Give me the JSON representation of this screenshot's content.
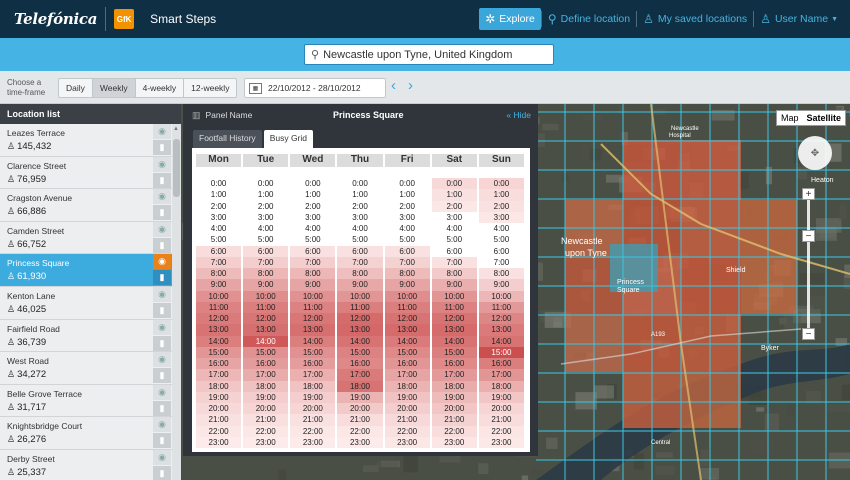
{
  "topbar": {
    "brand": "Telefónica",
    "partner": "GfK",
    "app_name": "Smart Steps",
    "nav": [
      {
        "label": "Explore",
        "icon": "compass-icon",
        "active": true
      },
      {
        "label": "Define location",
        "icon": "pin-icon"
      },
      {
        "label": "My saved locations",
        "icon": "person-icon"
      },
      {
        "label": "User Name",
        "icon": "user-icon"
      }
    ]
  },
  "search": {
    "value": "Newcastle upon Tyne, United Kingdom"
  },
  "timeframe": {
    "label": "Choose a time-frame",
    "options": [
      "Daily",
      "Weekly",
      "4-weekly",
      "12-weekly"
    ],
    "selected": "Weekly",
    "date_range": "22/10/2012 - 28/10/2012"
  },
  "sidebar": {
    "title": "Location list",
    "items": [
      {
        "name": "Leazes Terrace",
        "count": "145,432"
      },
      {
        "name": "Clarence Street",
        "count": "76,959"
      },
      {
        "name": "Cragston Avenue",
        "count": "66,886"
      },
      {
        "name": "Camden Street",
        "count": "66,752"
      },
      {
        "name": "Princess Square",
        "count": "61,930",
        "selected": true
      },
      {
        "name": "Kenton Lane",
        "count": "46,025"
      },
      {
        "name": "Fairfield Road",
        "count": "36,739"
      },
      {
        "name": "West Road",
        "count": "34,272"
      },
      {
        "name": "Belle Grove Terrace",
        "count": "31,717"
      },
      {
        "name": "Knightsbridge Court",
        "count": "26,276"
      },
      {
        "name": "Derby Street",
        "count": "25,337"
      }
    ]
  },
  "panel": {
    "label": "Panel Name",
    "value": "Princess Square",
    "hide": "« Hide",
    "tabs": [
      "Footfall History",
      "Busy Grid"
    ],
    "active_tab": "Busy Grid",
    "days": [
      "Mon",
      "Tue",
      "Wed",
      "Thu",
      "Fri",
      "Sat",
      "Sun"
    ],
    "hours": [
      "0:00",
      "1:00",
      "2:00",
      "3:00",
      "4:00",
      "5:00",
      "6:00",
      "7:00",
      "8:00",
      "9:00",
      "10:00",
      "11:00",
      "12:00",
      "13:00",
      "14:00",
      "15:00",
      "16:00",
      "17:00",
      "18:00",
      "19:00",
      "20:00",
      "21:00",
      "22:00",
      "23:00"
    ],
    "busy": [
      [
        0,
        0,
        0,
        0,
        0,
        0,
        0.1,
        0.18,
        0.28,
        0.4,
        0.5,
        0.58,
        0.62,
        0.66,
        0.6,
        0.48,
        0.4,
        0.3,
        0.22,
        0.16,
        0.12,
        0.08,
        0.05,
        0.03
      ],
      [
        0,
        0,
        0,
        0,
        0,
        0,
        0.1,
        0.18,
        0.3,
        0.4,
        0.52,
        0.6,
        0.65,
        0.68,
        0.8,
        0.5,
        0.45,
        0.36,
        0.25,
        0.18,
        0.14,
        0.09,
        0.05,
        0.03
      ],
      [
        0,
        0,
        0,
        0,
        0,
        0,
        0.08,
        0.18,
        0.3,
        0.4,
        0.5,
        0.58,
        0.64,
        0.68,
        0.6,
        0.5,
        0.44,
        0.34,
        0.24,
        0.18,
        0.14,
        0.08,
        0.05,
        0.03
      ],
      [
        0,
        0,
        0,
        0,
        0,
        0,
        0.08,
        0.16,
        0.26,
        0.38,
        0.48,
        0.6,
        0.7,
        0.72,
        0.66,
        0.58,
        0.55,
        0.62,
        0.66,
        0.32,
        0.2,
        0.1,
        0.05,
        0.03
      ],
      [
        0,
        0,
        0,
        0,
        0,
        0,
        0.08,
        0.16,
        0.28,
        0.4,
        0.52,
        0.6,
        0.66,
        0.7,
        0.62,
        0.54,
        0.48,
        0.4,
        0.32,
        0.24,
        0.18,
        0.12,
        0.08,
        0.05
      ],
      [
        0.12,
        0.08,
        0.05,
        0,
        0,
        0,
        0,
        0.08,
        0.2,
        0.35,
        0.48,
        0.58,
        0.66,
        0.7,
        0.66,
        0.6,
        0.54,
        0.46,
        0.36,
        0.28,
        0.22,
        0.16,
        0.1,
        0.06
      ],
      [
        0.14,
        0.1,
        0.08,
        0.05,
        0,
        0,
        0,
        0,
        0.08,
        0.18,
        0.3,
        0.46,
        0.56,
        0.62,
        0.66,
        0.85,
        0.6,
        0.48,
        0.34,
        0.22,
        0.14,
        0.1,
        0.06,
        0.04
      ]
    ]
  }
}
